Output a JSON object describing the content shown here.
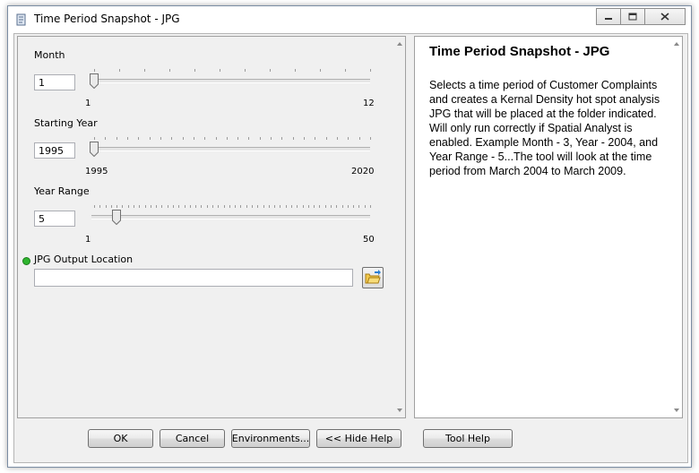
{
  "window": {
    "title": "Time Period Snapshot - JPG",
    "icon": "script-tool-icon"
  },
  "params": {
    "month": {
      "label": "Month",
      "value": "1",
      "min_label": "1",
      "max_label": "12",
      "min": 1,
      "max": 12,
      "current": 1
    },
    "year": {
      "label": "Starting Year",
      "value": "1995",
      "min_label": "1995",
      "max_label": "2020",
      "min": 1995,
      "max": 2020,
      "current": 1995
    },
    "range": {
      "label": "Year Range",
      "value": "5",
      "min_label": "1",
      "max_label": "50",
      "min": 1,
      "max": 50,
      "current": 5
    },
    "output": {
      "label": "JPG Output Location",
      "value": ""
    }
  },
  "help": {
    "title": "Time Period Snapshot - JPG",
    "body": "Selects a time period of Customer Complaints and creates a Kernal Density hot spot analysis JPG that will be placed at the folder indicated. Will only run correctly if Spatial Analyst is enabled. Example Month - 3, Year - 2004, and Year Range - 5...The tool will look at the time period from March 2004 to March 2009."
  },
  "buttons": {
    "ok": "OK",
    "cancel": "Cancel",
    "environments": "Environments...",
    "hide_help": "<< Hide Help",
    "tool_help": "Tool Help"
  }
}
